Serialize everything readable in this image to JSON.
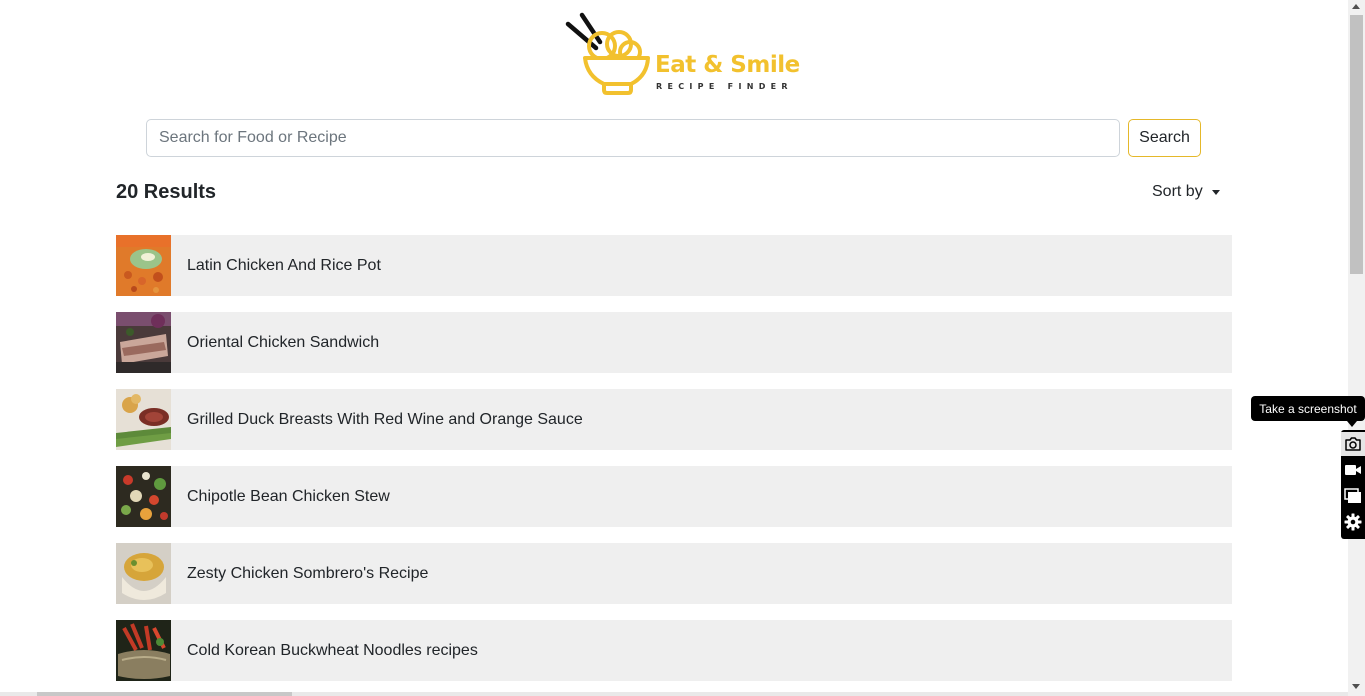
{
  "brand": {
    "name": "Eat & Smile",
    "tagline": "RECIPE FINDER",
    "color": "#f2c12e"
  },
  "search": {
    "placeholder": "Search for Food or Recipe",
    "value": "",
    "button_label": "Search"
  },
  "results": {
    "count_label": "20 Results",
    "sort_label": "Sort by",
    "items": [
      {
        "title": "Latin Chicken And Rice Pot",
        "thumb": "food-thumbnail"
      },
      {
        "title": "Oriental Chicken Sandwich",
        "thumb": "food-thumbnail"
      },
      {
        "title": "Grilled Duck Breasts With Red Wine and Orange Sauce",
        "thumb": "food-thumbnail"
      },
      {
        "title": "Chipotle Bean Chicken Stew",
        "thumb": "food-thumbnail"
      },
      {
        "title": "Zesty Chicken Sombrero's Recipe",
        "thumb": "food-thumbnail"
      },
      {
        "title": "Cold Korean Buckwheat Noodles recipes",
        "thumb": "food-thumbnail"
      }
    ]
  },
  "extension": {
    "tooltip": "Take a screenshot",
    "tools": [
      "camera-icon",
      "video-camera-icon",
      "window-capture-icon",
      "gear-icon"
    ]
  }
}
